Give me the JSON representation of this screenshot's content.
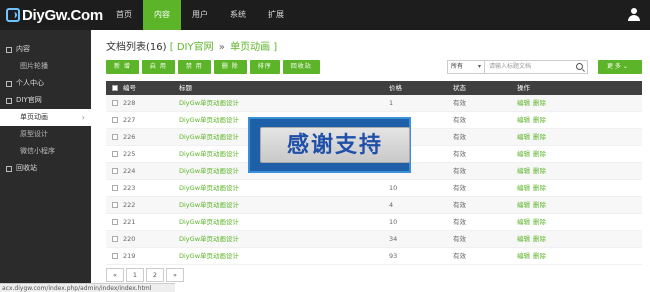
{
  "logo": {
    "text": "DiyGw.Com"
  },
  "nav": [
    {
      "label": "首页",
      "active": false
    },
    {
      "label": "内容",
      "active": true
    },
    {
      "label": "用户",
      "active": false
    },
    {
      "label": "系统",
      "active": false
    },
    {
      "label": "扩展",
      "active": false
    }
  ],
  "sidebar": {
    "groups": [
      {
        "label": "内容",
        "items": [
          {
            "label": "图片轮播",
            "active": false
          }
        ]
      },
      {
        "label": "个人中心",
        "items": []
      },
      {
        "label": "DIY官网",
        "items": [
          {
            "label": "单页动画",
            "active": true
          },
          {
            "label": "原型设计",
            "active": false
          },
          {
            "label": "微信小程序",
            "active": false
          }
        ]
      },
      {
        "label": "回收站",
        "items": []
      }
    ]
  },
  "breadcrumb": {
    "prefix": "文档列表(16)",
    "lb": "[",
    "site": "DIY官网",
    "sep": "»",
    "page": "单页动画",
    "rb": "]"
  },
  "toolbar": {
    "buttons": [
      "新 增",
      "启 用",
      "禁 用",
      "删 除",
      "排序",
      "回收站"
    ]
  },
  "filter": {
    "selected": "所有"
  },
  "search": {
    "placeholder": "请输入标题文档"
  },
  "more_button": {
    "label": "更 多"
  },
  "table": {
    "headers": {
      "id": "编号",
      "title": "标题",
      "price": "价格",
      "status": "状态",
      "ops": "操作"
    },
    "rows": [
      {
        "id": "228",
        "title": "DiyGw单页动画设计",
        "price": "1",
        "status": "有效"
      },
      {
        "id": "227",
        "title": "DiyGw单页动画设计",
        "price": "",
        "status": "有效"
      },
      {
        "id": "226",
        "title": "DiyGw单页动画设计",
        "price": "",
        "status": "有效"
      },
      {
        "id": "225",
        "title": "DiyGw单页动画设计",
        "price": "",
        "status": "有效"
      },
      {
        "id": "224",
        "title": "DiyGw单页动画设计",
        "price": "",
        "status": "有效"
      },
      {
        "id": "223",
        "title": "DiyGw单页动画设计",
        "price": "10",
        "status": "有效"
      },
      {
        "id": "222",
        "title": "DiyGw单页动画设计",
        "price": "4",
        "status": "有效"
      },
      {
        "id": "221",
        "title": "DiyGw单页动画设计",
        "price": "10",
        "status": "有效"
      },
      {
        "id": "220",
        "title": "DiyGw单页动画设计",
        "price": "34",
        "status": "有效"
      },
      {
        "id": "219",
        "title": "DiyGw单页动画设计",
        "price": "93",
        "status": "有效"
      }
    ],
    "op_edit": "编辑",
    "op_delete": "删除"
  },
  "pager": [
    "«",
    "1",
    "2",
    "»"
  ],
  "statusbar": {
    "url": "acx.diygw.com/index.php/admin/index/index.html"
  },
  "banner": {
    "text": "感谢支持"
  },
  "colors": {
    "accent": "#5cb529",
    "topbar": "#1d1d1d",
    "sidebar": "#2b2b2b"
  }
}
